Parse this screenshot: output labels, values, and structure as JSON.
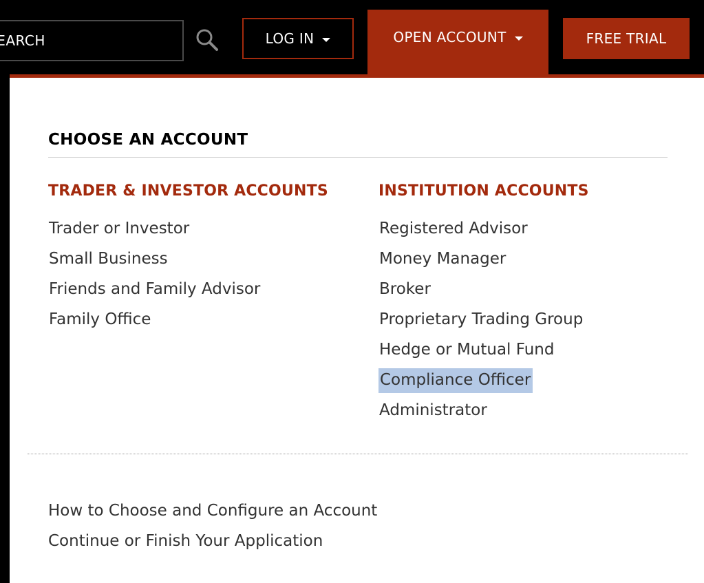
{
  "header": {
    "search": {
      "placeholder": "SEARCH",
      "icon": "search-icon"
    },
    "login_label": "LOG IN",
    "open_account_label": "OPEN ACCOUNT",
    "free_trial_label": "FREE TRIAL"
  },
  "colors": {
    "brand_red": "#a32a0d",
    "bar_black": "#000000",
    "selection": "#b4c9e6"
  },
  "dropdown": {
    "title": "CHOOSE AN ACCOUNT",
    "columns": [
      {
        "heading": "TRADER & INVESTOR ACCOUNTS",
        "items": [
          "Trader or Investor",
          "Small Business",
          "Friends and Family Advisor",
          "Family Office"
        ]
      },
      {
        "heading": "INSTITUTION ACCOUNTS",
        "items": [
          "Registered Advisor",
          "Money Manager",
          "Broker",
          "Proprietary Trading Group",
          "Hedge or Mutual Fund",
          "Compliance Officer",
          "Administrator"
        ]
      }
    ],
    "footer_links": [
      "How to Choose and Configure an Account",
      "Continue or Finish Your Application"
    ]
  }
}
